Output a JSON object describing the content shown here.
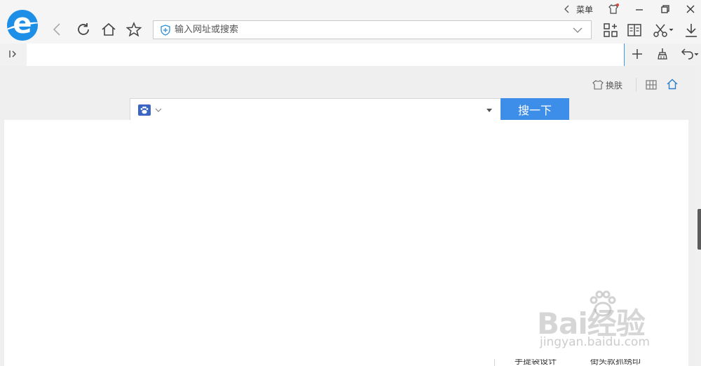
{
  "window": {
    "menu_label": "菜单"
  },
  "address_bar": {
    "placeholder": "输入网址或搜索"
  },
  "page": {
    "skin_label": "换肤",
    "search_button_label": "搜一下",
    "search_engine_icon": "baidu-paw-icon"
  },
  "bottom_strip": {
    "left_text": "手提袋设计",
    "right_text": "街头款抓绣印"
  },
  "watermark": {
    "brand": "Bai经验",
    "url": "jingyan.baidu.com"
  },
  "colors": {
    "accent": "#3d8ee8",
    "logo_blue": "#1e8fe6",
    "scroll_thumb": "#5b5b5b"
  }
}
